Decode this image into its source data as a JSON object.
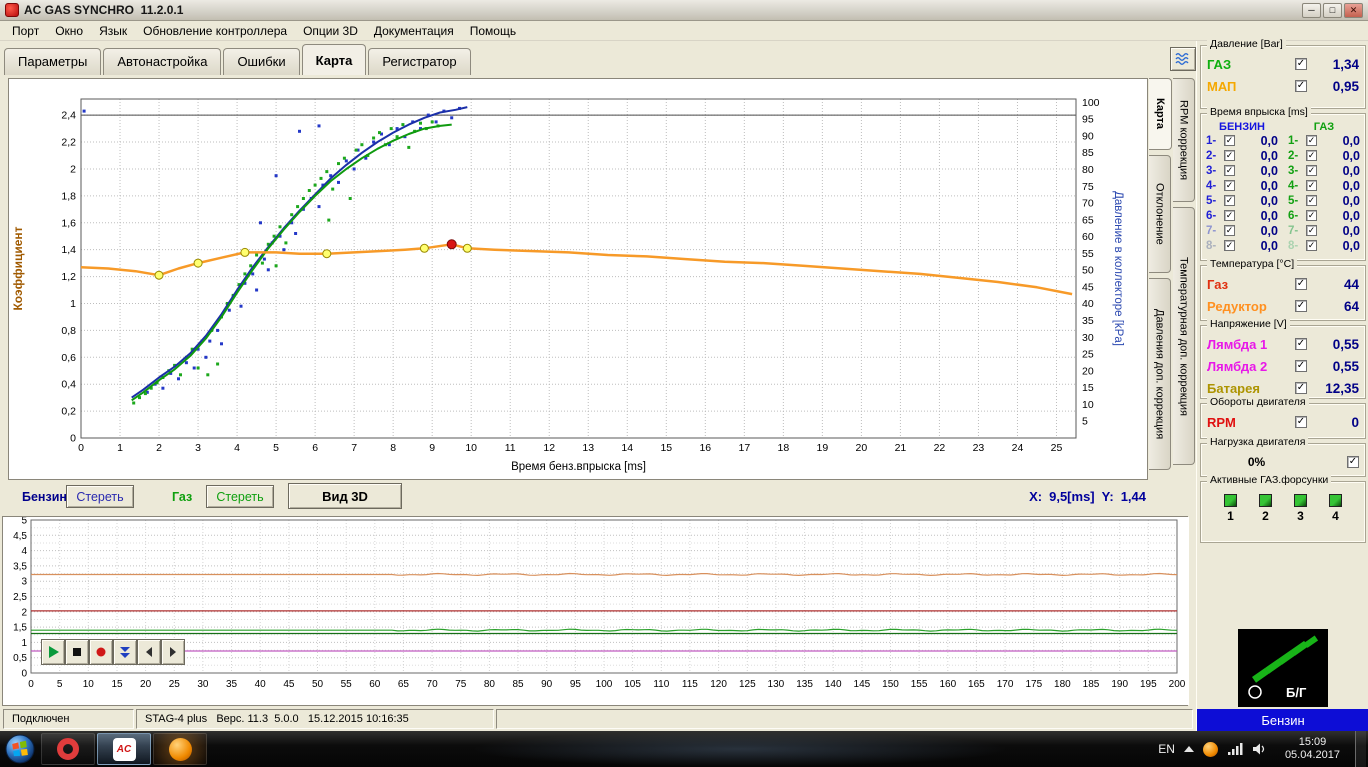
{
  "window": {
    "title": "AC GAS SYNCHRO  11.2.0.1",
    "buttons": {
      "minimize": "─",
      "maximize": "□",
      "close": "✕"
    }
  },
  "menu": [
    "Порт",
    "Окно",
    "Язык",
    "Обновление контроллера",
    "Опции 3D",
    "Документация",
    "Помощь"
  ],
  "tabs": [
    "Параметры",
    "Автонастройка",
    "Ошибки",
    "Карта",
    "Регистратор"
  ],
  "side_tabs": [
    "Карта",
    "RPM коррекция",
    "Отклонение",
    "Температурная доп. коррекция",
    "Давления доп. коррекция"
  ],
  "chart_controls": {
    "benzine_label": "Бензин",
    "benzine_clear": "Стереть",
    "gas_label": "Газ",
    "gas_clear": "Стереть",
    "view_3d": "Вид 3D",
    "cursor_x_label": "X:",
    "cursor_x_value": "9,5[ms]",
    "cursor_y_label": "Y:",
    "cursor_y_value": "1,44"
  },
  "panel": {
    "pressure": {
      "title": "Давление [Bar]",
      "rows": [
        {
          "label": "ГАЗ",
          "value": "1,34",
          "color": "#0faf0f"
        },
        {
          "label": "МАП",
          "value": "0,95",
          "color": "#f5a800"
        }
      ]
    },
    "injection": {
      "title": "Время впрыска [ms]",
      "col_benzine": "БЕНЗИН",
      "col_benzine_color": "#1414e0",
      "col_gas": "ГАЗ",
      "col_gas_color": "#0fa00f",
      "rows": [
        {
          "n": "1-",
          "b": "0,0",
          "g": "0,0",
          "bc": "#1f1fd6",
          "gc": "#12a012"
        },
        {
          "n": "2-",
          "b": "0,0",
          "g": "0,0",
          "bc": "#1f1fd6",
          "gc": "#12a012"
        },
        {
          "n": "3-",
          "b": "0,0",
          "g": "0,0",
          "bc": "#1f1fd6",
          "gc": "#12a012"
        },
        {
          "n": "4-",
          "b": "0,0",
          "g": "0,0",
          "bc": "#1f1fd6",
          "gc": "#12a012"
        },
        {
          "n": "5-",
          "b": "0,0",
          "g": "0,0",
          "bc": "#1f1fd6",
          "gc": "#12a012"
        },
        {
          "n": "6-",
          "b": "0,0",
          "g": "0,0",
          "bc": "#1f1fd6",
          "gc": "#12a012"
        },
        {
          "n": "7-",
          "b": "0,0",
          "g": "0,0",
          "bc": "#8d93cf",
          "gc": "#84c48e"
        },
        {
          "n": "8-",
          "b": "0,0",
          "g": "0,0",
          "bc": "#aab0bd",
          "gc": "#abd3b0"
        }
      ]
    },
    "temperature": {
      "title": "Температура [°C]",
      "rows": [
        {
          "label": "Газ",
          "value": "44",
          "color": "#e03010"
        },
        {
          "label": "Редуктор",
          "value": "64",
          "color": "#ff9020"
        }
      ]
    },
    "voltage": {
      "title": "Напряжение [V]",
      "rows": [
        {
          "label": "Лямбда 1",
          "value": "0,55",
          "color": "#e818e8"
        },
        {
          "label": "Лямбда 2",
          "value": "0,55",
          "color": "#e818e8"
        },
        {
          "label": "Батарея",
          "value": "12,35",
          "color": "#ad9400"
        }
      ]
    },
    "rpm": {
      "title": "Обороты двигателя",
      "label": "RPM",
      "value": "0",
      "color": "#e01010"
    },
    "load": {
      "title": "Нагрузка двигателя",
      "value": "0%"
    },
    "injectors": {
      "title": "Активные ГАЗ.форсунки",
      "items": [
        "1",
        "2",
        "3",
        "4"
      ]
    },
    "logo_text": "Б/Г",
    "fuel_mode": "Бензин"
  },
  "statusbar": {
    "connection": "Подключен",
    "device": "STAG-4 plus   Верс. 11.3  5.0.0   15.12.2015 10:16:35"
  },
  "taskbar": {
    "language": "EN",
    "time": "15:09",
    "date": "05.04.2017",
    "ac_label": "AC"
  },
  "chart_data": [
    {
      "id": "main-map",
      "type": "scatter",
      "xlabel": "Время бенз.впрыска [ms]",
      "ylabel_left": "Коэффициент",
      "ylabel_right": "Давление в коллекторе [kPa]",
      "xlim": [
        0,
        25.5
      ],
      "x_tick_step": 1,
      "x_tick_max": 25,
      "ylim_left": [
        0,
        2.52
      ],
      "y_tick_left_step": 0.2,
      "y_tick_left_max": 2.4,
      "ylim_right": [
        0,
        101
      ],
      "y_tick_right_step": 5,
      "y_tick_right_max": 100,
      "ref_line": 2.4,
      "grid": true,
      "cursor": {
        "x": 9.5,
        "y": 1.44
      },
      "series": [
        {
          "name": "benzine-points",
          "type": "scatter",
          "color": "#2438c8",
          "points": [
            [
              0.08,
              2.43
            ],
            [
              1.7,
              0.34
            ],
            [
              1.9,
              0.4
            ],
            [
              2.1,
              0.37
            ],
            [
              2.3,
              0.48
            ],
            [
              2.5,
              0.44
            ],
            [
              2.7,
              0.56
            ],
            [
              2.9,
              0.52
            ],
            [
              3.0,
              0.66
            ],
            [
              3.2,
              0.6
            ],
            [
              3.3,
              0.72
            ],
            [
              3.5,
              0.8
            ],
            [
              3.6,
              0.7
            ],
            [
              3.8,
              0.95
            ],
            [
              3.9,
              1.05
            ],
            [
              4.1,
              0.98
            ],
            [
              4.2,
              1.15
            ],
            [
              4.4,
              1.22
            ],
            [
              4.5,
              1.1
            ],
            [
              4.7,
              1.33
            ],
            [
              4.8,
              1.25
            ],
            [
              4.9,
              1.45
            ],
            [
              5.1,
              1.5
            ],
            [
              5.2,
              1.4
            ],
            [
              5.4,
              1.6
            ],
            [
              5.5,
              1.52
            ],
            [
              5.7,
              1.7
            ],
            [
              5.9,
              1.78
            ],
            [
              6.1,
              1.72
            ],
            [
              6.2,
              1.88
            ],
            [
              6.4,
              1.95
            ],
            [
              6.6,
              1.9
            ],
            [
              6.8,
              2.06
            ],
            [
              7.0,
              2.0
            ],
            [
              7.1,
              2.14
            ],
            [
              7.3,
              2.08
            ],
            [
              7.5,
              2.2
            ],
            [
              7.7,
              2.26
            ],
            [
              7.9,
              2.18
            ],
            [
              8.1,
              2.3
            ],
            [
              8.3,
              2.24
            ],
            [
              8.5,
              2.35
            ],
            [
              8.7,
              2.3
            ],
            [
              8.9,
              2.4
            ],
            [
              9.1,
              2.35
            ],
            [
              9.3,
              2.43
            ],
            [
              9.5,
              2.38
            ],
            [
              9.7,
              2.45
            ],
            [
              5.0,
              1.95
            ],
            [
              5.6,
              2.28
            ],
            [
              6.1,
              2.32
            ],
            [
              4.6,
              1.6
            ]
          ]
        },
        {
          "name": "gas-points",
          "type": "scatter",
          "color": "#1da81d",
          "points": [
            [
              1.35,
              0.26
            ],
            [
              1.5,
              0.3
            ],
            [
              1.65,
              0.33
            ],
            [
              1.8,
              0.37
            ],
            [
              1.95,
              0.41
            ],
            [
              2.1,
              0.45
            ],
            [
              2.25,
              0.5
            ],
            [
              2.4,
              0.54
            ],
            [
              2.55,
              0.47
            ],
            [
              2.7,
              0.6
            ],
            [
              2.85,
              0.66
            ],
            [
              3.0,
              0.52
            ],
            [
              3.1,
              0.72
            ],
            [
              3.25,
              0.47
            ],
            [
              3.35,
              0.8
            ],
            [
              3.5,
              0.55
            ],
            [
              3.6,
              0.9
            ],
            [
              3.75,
              1.0
            ],
            [
              3.9,
              1.06
            ],
            [
              4.05,
              1.14
            ],
            [
              4.2,
              1.22
            ],
            [
              4.35,
              1.28
            ],
            [
              4.5,
              1.36
            ],
            [
              4.65,
              1.3
            ],
            [
              4.8,
              1.44
            ],
            [
              4.95,
              1.5
            ],
            [
              5.1,
              1.57
            ],
            [
              5.25,
              1.45
            ],
            [
              5.4,
              1.66
            ],
            [
              5.55,
              1.72
            ],
            [
              5.7,
              1.78
            ],
            [
              5.85,
              1.84
            ],
            [
              6.0,
              1.88
            ],
            [
              6.15,
              1.93
            ],
            [
              6.3,
              1.98
            ],
            [
              6.45,
              1.85
            ],
            [
              6.6,
              2.04
            ],
            [
              6.75,
              2.08
            ],
            [
              6.9,
              1.78
            ],
            [
              7.05,
              2.14
            ],
            [
              7.2,
              2.18
            ],
            [
              7.35,
              2.1
            ],
            [
              7.5,
              2.23
            ],
            [
              7.65,
              2.27
            ],
            [
              7.8,
              2.18
            ],
            [
              7.95,
              2.3
            ],
            [
              8.1,
              2.24
            ],
            [
              8.25,
              2.33
            ],
            [
              8.4,
              2.16
            ],
            [
              8.55,
              2.28
            ],
            [
              8.7,
              2.34
            ],
            [
              8.85,
              2.3
            ],
            [
              9.0,
              2.35
            ],
            [
              9.15,
              2.32
            ],
            [
              6.35,
              1.62
            ],
            [
              5.0,
              1.28
            ]
          ]
        },
        {
          "name": "benzine-curve",
          "type": "line",
          "color": "#1b2fa8",
          "width": 2,
          "points": [
            [
              1.3,
              0.3
            ],
            [
              1.6,
              0.36
            ],
            [
              2.0,
              0.45
            ],
            [
              2.4,
              0.53
            ],
            [
              2.8,
              0.63
            ],
            [
              3.2,
              0.76
            ],
            [
              3.6,
              0.92
            ],
            [
              4.0,
              1.1
            ],
            [
              4.4,
              1.27
            ],
            [
              4.8,
              1.42
            ],
            [
              5.2,
              1.56
            ],
            [
              5.6,
              1.69
            ],
            [
              6.0,
              1.81
            ],
            [
              6.4,
              1.93
            ],
            [
              6.8,
              2.03
            ],
            [
              7.2,
              2.12
            ],
            [
              7.6,
              2.2
            ],
            [
              8.0,
              2.27
            ],
            [
              8.4,
              2.33
            ],
            [
              8.8,
              2.38
            ],
            [
              9.2,
              2.42
            ],
            [
              9.6,
              2.44
            ],
            [
              9.9,
              2.46
            ]
          ]
        },
        {
          "name": "gas-curve",
          "type": "line",
          "color": "#0f9a0f",
          "width": 2,
          "points": [
            [
              1.3,
              0.28
            ],
            [
              1.6,
              0.34
            ],
            [
              2.0,
              0.43
            ],
            [
              2.4,
              0.51
            ],
            [
              2.8,
              0.61
            ],
            [
              3.2,
              0.74
            ],
            [
              3.6,
              0.9
            ],
            [
              4.0,
              1.08
            ],
            [
              4.4,
              1.25
            ],
            [
              4.8,
              1.41
            ],
            [
              5.2,
              1.55
            ],
            [
              5.6,
              1.68
            ],
            [
              6.0,
              1.8
            ],
            [
              6.4,
              1.91
            ],
            [
              6.8,
              2.0
            ],
            [
              7.2,
              2.08
            ],
            [
              7.6,
              2.15
            ],
            [
              8.0,
              2.21
            ],
            [
              8.4,
              2.26
            ],
            [
              8.8,
              2.3
            ],
            [
              9.2,
              2.32
            ],
            [
              9.5,
              2.33
            ]
          ]
        },
        {
          "name": "coefficient-map",
          "type": "line",
          "color": "#f79a28",
          "width": 2.5,
          "points": [
            [
              0,
              1.27
            ],
            [
              0.7,
              1.26
            ],
            [
              1.4,
              1.24
            ],
            [
              2.0,
              1.21
            ],
            [
              2.5,
              1.26
            ],
            [
              3.0,
              1.3
            ],
            [
              3.6,
              1.34
            ],
            [
              4.2,
              1.38
            ],
            [
              5.0,
              1.38
            ],
            [
              5.6,
              1.37
            ],
            [
              6.3,
              1.37
            ],
            [
              7.0,
              1.38
            ],
            [
              7.7,
              1.39
            ],
            [
              8.3,
              1.4
            ],
            [
              8.8,
              1.41
            ],
            [
              9.5,
              1.44
            ],
            [
              9.9,
              1.41
            ],
            [
              10.6,
              1.4
            ],
            [
              11.5,
              1.39
            ],
            [
              12.5,
              1.38
            ],
            [
              13.5,
              1.36
            ],
            [
              14.5,
              1.35
            ],
            [
              15.5,
              1.33
            ],
            [
              16.5,
              1.31
            ],
            [
              17.5,
              1.3
            ],
            [
              18.5,
              1.28
            ],
            [
              19.5,
              1.26
            ],
            [
              20.5,
              1.24
            ],
            [
              21.5,
              1.22
            ],
            [
              22.5,
              1.19
            ],
            [
              23.5,
              1.16
            ],
            [
              24.5,
              1.12
            ],
            [
              25.4,
              1.07
            ]
          ],
          "markers": [
            [
              2.0,
              1.21
            ],
            [
              3.0,
              1.3
            ],
            [
              4.2,
              1.38
            ],
            [
              6.3,
              1.37
            ],
            [
              8.8,
              1.41
            ],
            [
              9.9,
              1.41
            ]
          ],
          "marker_fill": "#ffff70",
          "marker_stroke": "#9a8a00",
          "selected": [
            9.5,
            1.44
          ],
          "selected_color": "#d81414"
        }
      ]
    },
    {
      "id": "registrar",
      "type": "line",
      "xlim": [
        0,
        200
      ],
      "x_tick_step": 5,
      "ylim": [
        0,
        5
      ],
      "y_tick_step": 0.5,
      "y_minor_step": 0.25,
      "series": [
        {
          "name": "map-pressure-trace",
          "color": "#d8905c",
          "level": 3.22,
          "ripple": true
        },
        {
          "name": "red-trace",
          "color": "#b03030",
          "level": 2.03,
          "ripple": false
        },
        {
          "name": "green-trace",
          "color": "#2aa02a",
          "level": 1.4,
          "ripple": true
        },
        {
          "name": "dark-green-trace",
          "color": "#177017",
          "level": 1.29,
          "ripple": false
        },
        {
          "name": "magenta-trace",
          "color": "#c05ac0",
          "level": 0.72,
          "ripple": false
        }
      ]
    }
  ]
}
